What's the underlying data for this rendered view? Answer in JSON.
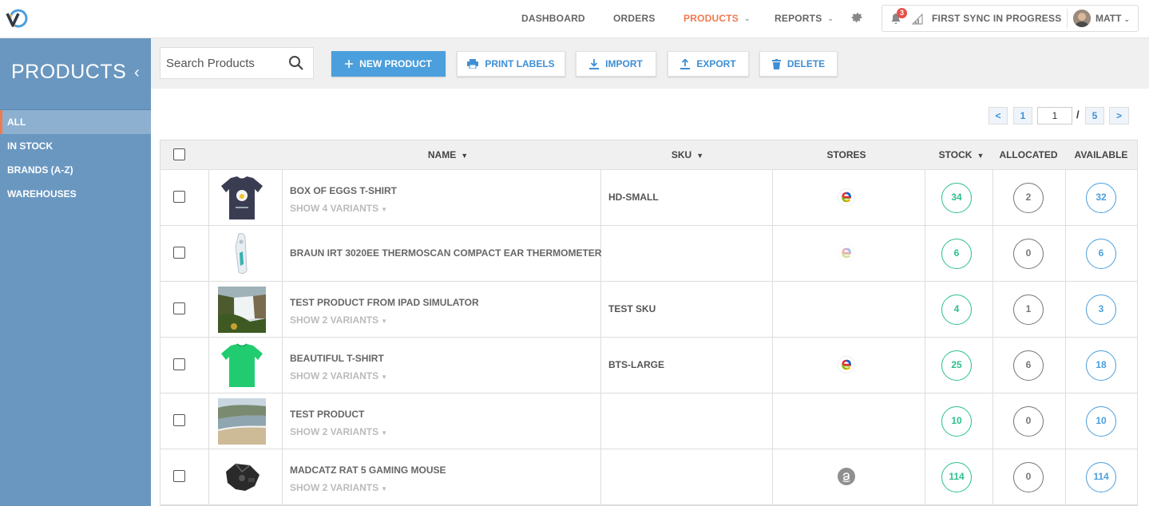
{
  "topnav": {
    "items": [
      {
        "label": "DASHBOARD",
        "caret": false,
        "active": false
      },
      {
        "label": "ORDERS",
        "caret": false,
        "active": false
      },
      {
        "label": "PRODUCTS",
        "caret": true,
        "active": true
      },
      {
        "label": "REPORTS",
        "caret": true,
        "active": false
      }
    ],
    "notification_count": "3",
    "sync_status": "FIRST SYNC IN PROGRESS",
    "user_name": "MATT",
    "accent_color": "#f07a4f"
  },
  "sidebar": {
    "title": "PRODUCTS",
    "items": [
      {
        "label": "ALL",
        "active": true
      },
      {
        "label": "IN STOCK",
        "active": false
      },
      {
        "label": "BRANDS (A-Z)",
        "active": false
      },
      {
        "label": "WAREHOUSES",
        "active": false
      }
    ]
  },
  "toolbar": {
    "search_placeholder": "Search Products",
    "new_product_label": "NEW PRODUCT",
    "print_labels_label": "PRINT LABELS",
    "import_label": "IMPORT",
    "export_label": "EXPORT",
    "delete_label": "DELETE"
  },
  "pagination": {
    "prev": "<",
    "first": "1",
    "current": "1",
    "separator": "/",
    "total": "5",
    "next": ">"
  },
  "table": {
    "headers": {
      "name": "NAME",
      "sku": "SKU",
      "stores": "STORES",
      "stock": "STOCK",
      "allocated": "ALLOCATED",
      "available": "AVAILABLE"
    },
    "rows": [
      {
        "name": "BOX OF EGGS T-SHIRT",
        "variants": "SHOW 4 VARIANTS",
        "sku": "HD-SMALL",
        "store": "ebay",
        "stock": "34",
        "allocated": "2",
        "available": "32",
        "thumb": "dark-tshirt"
      },
      {
        "name": "BRAUN IRT 3020EE THERMOSCAN COMPACT EAR THERMOMETER",
        "variants": "",
        "sku": "",
        "store": "ebay-faded",
        "stock": "6",
        "allocated": "0",
        "available": "6",
        "thumb": "thermometer"
      },
      {
        "name": "TEST PRODUCT FROM IPAD SIMULATOR",
        "variants": "SHOW 2 VARIANTS",
        "sku": "TEST SKU",
        "store": "",
        "stock": "4",
        "allocated": "1",
        "available": "3",
        "thumb": "waterfall"
      },
      {
        "name": "BEAUTIFUL T-SHIRT",
        "variants": "SHOW 2 VARIANTS",
        "sku": "BTS-LARGE",
        "store": "ebay",
        "stock": "25",
        "allocated": "6",
        "available": "18",
        "thumb": "green-tshirt"
      },
      {
        "name": "TEST PRODUCT",
        "variants": "SHOW 2 VARIANTS",
        "sku": "",
        "store": "",
        "stock": "10",
        "allocated": "0",
        "available": "10",
        "thumb": "beach"
      },
      {
        "name": "MADCATZ RAT 5 GAMING MOUSE",
        "variants": "SHOW 2 VARIANTS",
        "sku": "",
        "store": "amazon",
        "stock": "114",
        "allocated": "0",
        "available": "114",
        "thumb": "mouse"
      }
    ]
  }
}
